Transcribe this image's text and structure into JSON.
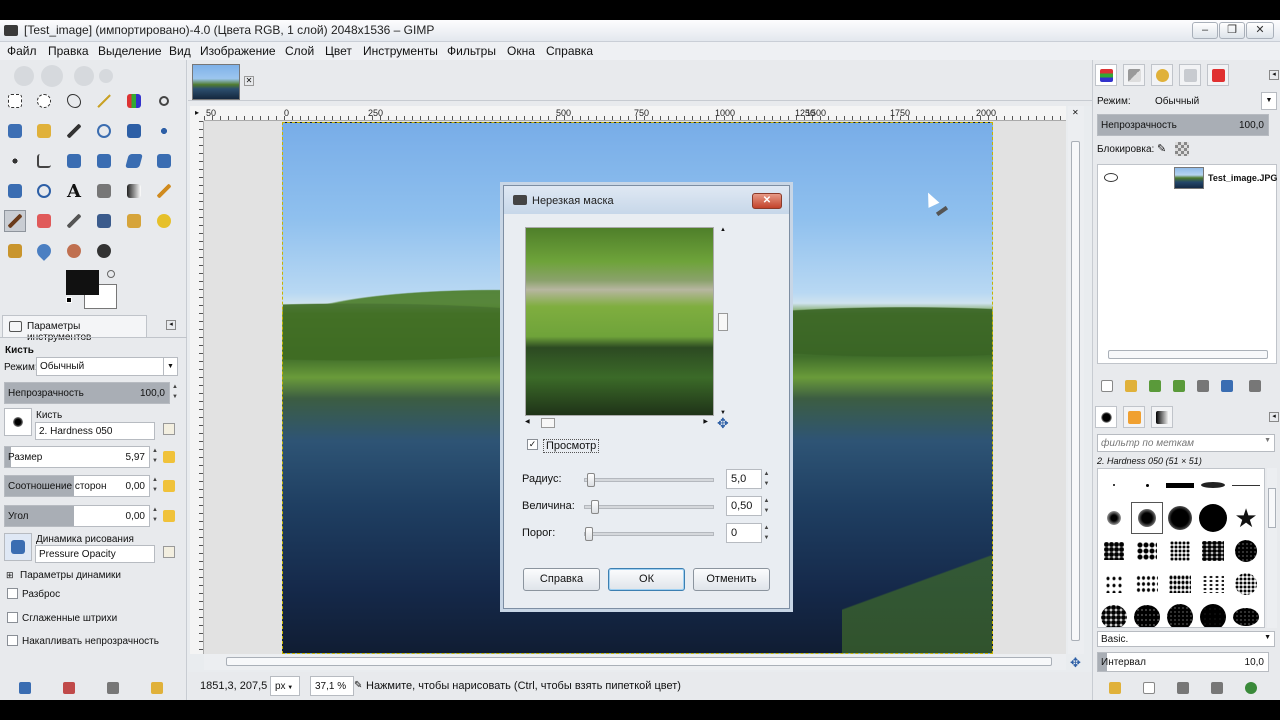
{
  "window": {
    "title": "[Test_image] (импортировано)-4.0 (Цвета RGB, 1 слой) 2048x1536 – GIMP",
    "min": "–",
    "max": "❐",
    "close": "✕"
  },
  "menu": [
    "Файл",
    "Правка",
    "Выделение",
    "Вид",
    "Изображение",
    "Слой",
    "Цвет",
    "Инструменты",
    "Фильтры",
    "Окна",
    "Справка"
  ],
  "left": {
    "tab_label": "Параметры инструментов",
    "tool_name": "Кисть",
    "mode_label": "Режим:",
    "mode_value": "Обычный",
    "opacity_label": "Непрозрачность",
    "opacity_value": "100,0",
    "brush_label": "Кисть",
    "brush_value": "2. Hardness 050",
    "size_label": "Размер",
    "size_value": "5,97",
    "aspect_label": "Соотношение сторон",
    "aspect_value": "0,00",
    "angle_label": "Угол",
    "angle_value": "0,00",
    "dynamics_label": "Динамика рисования",
    "dynamics_value": "Pressure Opacity",
    "dyn_params": "Параметры динамики",
    "scatter": "Разброс",
    "smooth": "Сглаженные штрихи",
    "accumulate": "Накапливать непрозрачность"
  },
  "ruler_h": [
    "50",
    "0",
    "250",
    "500",
    "750",
    "1000",
    "1250",
    "1500",
    "1750",
    "2000"
  ],
  "status": {
    "coords": "1851,3, 207,5",
    "unit": "px",
    "zoom": "37,1 %",
    "message": "Нажмите, чтобы нарисовать (Ctrl, чтобы взять пипеткой цвет)"
  },
  "dialog": {
    "title": "Нерезкая маска",
    "preview_label": "Просмотр",
    "radius_label": "Радиус:",
    "radius_value": "5,0",
    "amount_label": "Величина:",
    "amount_value": "0,50",
    "threshold_label": "Порог:",
    "threshold_value": "0",
    "help": "Справка",
    "ok": "ОК",
    "cancel": "Отменить"
  },
  "right": {
    "mode_label": "Режим:",
    "mode_value": "Обычный",
    "opacity_label": "Непрозрачность",
    "opacity_value": "100,0",
    "lock_label": "Блокировка:",
    "layer_name": "Test_image.JPG",
    "filter_placeholder": "фильтр по меткам",
    "brush_name": "2. Hardness 050 (51 × 51)",
    "preset": "Basic.",
    "spacing_label": "Интервал",
    "spacing_value": "10,0"
  },
  "colors": {
    "accent": "#3c7fb1",
    "close": "#c2422b"
  }
}
